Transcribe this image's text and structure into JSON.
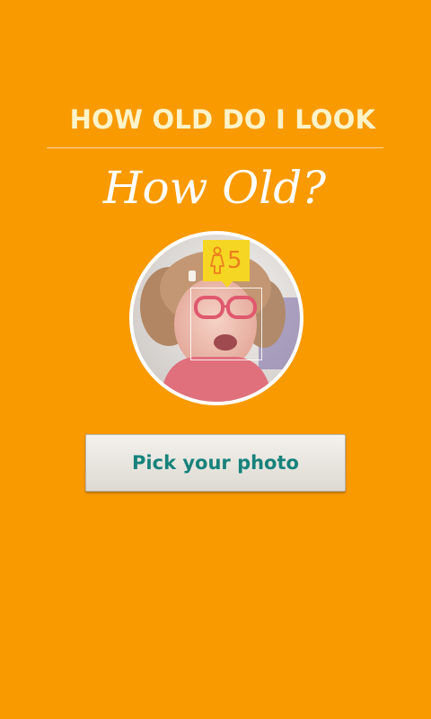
{
  "header": {
    "title": "HOW OLD DO I LOOK"
  },
  "main": {
    "heading": "How Old?",
    "face_result": {
      "gender_icon": "female-person-icon",
      "age": "5"
    },
    "pick_button_label": "Pick your photo"
  },
  "colors": {
    "background": "#F89A00",
    "header_text": "#FDF3C9",
    "badge": "#F5D622",
    "badge_text": "#EC7D1E",
    "button_text": "#17827B"
  }
}
